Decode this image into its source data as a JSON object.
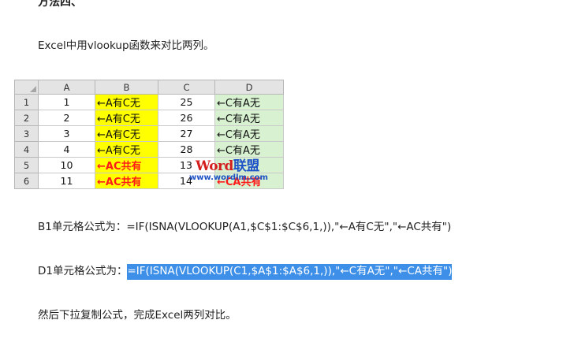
{
  "heading": "方法四、",
  "intro": "Excel中用vlookup函数来对比两列。",
  "sheet": {
    "col_headers": [
      "A",
      "B",
      "C",
      "D"
    ],
    "rows": [
      {
        "n": "1",
        "a": "1",
        "b": "←A有C无",
        "c": "25",
        "d": "←C有A无"
      },
      {
        "n": "2",
        "a": "2",
        "b": "←A有C无",
        "c": "26",
        "d": "←C有A无"
      },
      {
        "n": "3",
        "a": "3",
        "b": "←A有C无",
        "c": "27",
        "d": "←C有A无"
      },
      {
        "n": "4",
        "a": "4",
        "b": "←A有C无",
        "c": "28",
        "d": "←C有A无"
      },
      {
        "n": "5",
        "a": "10",
        "b": "←AC共有",
        "c": "13",
        "d": ""
      },
      {
        "n": "6",
        "a": "11",
        "b": "←AC共有",
        "c": "14",
        "d": "←CA共有"
      }
    ]
  },
  "watermark": {
    "part1": "Word",
    "part2": "联盟",
    "url": "www.wordlm.com"
  },
  "b1_formula": "B1单元格公式为：=IF(ISNA(VLOOKUP(A1,$C$1:$C$6,1,)),\"←A有C无\",\"←AC共有\")",
  "d1_label": "D1单元格公式为：",
  "d1_formula": "=IF(ISNA(VLOOKUP(C1,$A$1:$A$6,1,)),\"←C有A无\",\"←CA共有\")",
  "final": "然后下拉复制公式，完成Excel两列对比。"
}
